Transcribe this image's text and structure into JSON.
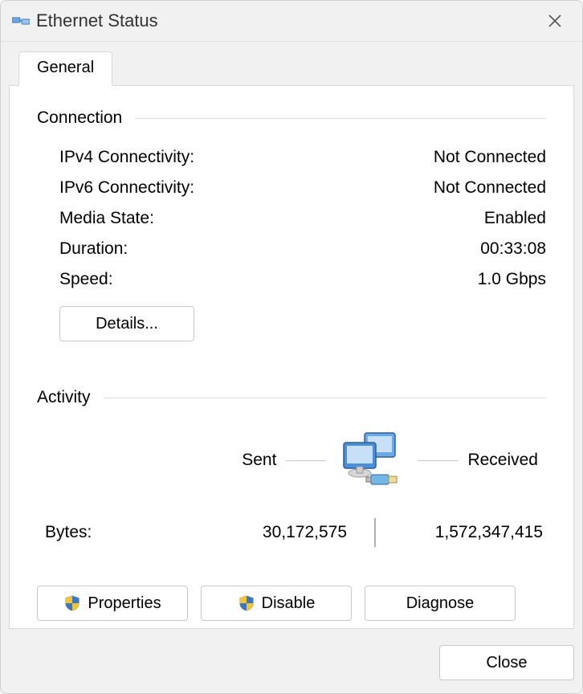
{
  "window": {
    "title": "Ethernet Status"
  },
  "tabs": {
    "general": "General"
  },
  "sections": {
    "connection": {
      "title": "Connection",
      "ipv4_label": "IPv4 Connectivity:",
      "ipv4_value": "Not Connected",
      "ipv6_label": "IPv6 Connectivity:",
      "ipv6_value": "Not Connected",
      "media_label": "Media State:",
      "media_value": "Enabled",
      "duration_label": "Duration:",
      "duration_value": "00:33:08",
      "speed_label": "Speed:",
      "speed_value": "1.0 Gbps"
    },
    "activity": {
      "title": "Activity",
      "sent_label": "Sent",
      "received_label": "Received",
      "bytes_label": "Bytes:",
      "bytes_sent": "30,172,575",
      "bytes_received": "1,572,347,415"
    }
  },
  "buttons": {
    "details": "Details...",
    "properties": "Properties",
    "disable": "Disable",
    "diagnose": "Diagnose",
    "close": "Close"
  }
}
